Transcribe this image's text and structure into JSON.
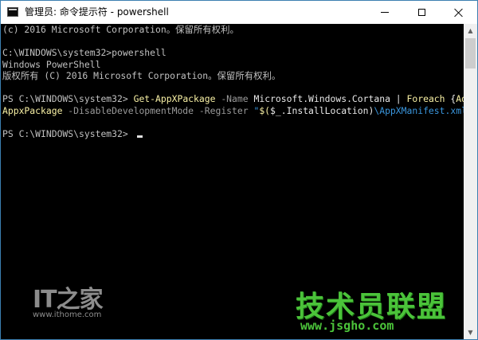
{
  "window": {
    "title": "管理员: 命令提示符 - powershell",
    "icon": "console-icon",
    "controls": {
      "minimize_icon": "minimize-icon",
      "maximize_icon": "maximize-icon",
      "close_icon": "close-icon"
    }
  },
  "console": {
    "lines": [
      "(c) 2016 Microsoft Corporation。保留所有权利。",
      "",
      "C:\\WINDOWS\\system32>powershell",
      "Windows PowerShell",
      "版权所有 (C) 2016 Microsoft Corporation。保留所有权利。",
      ""
    ],
    "command_line_1": {
      "prompt": "PS C:\\WINDOWS\\system32> ",
      "cmdlet": "Get-AppXPackage",
      "param_name": " -Name ",
      "package_name": "Microsoft.Windows.Cortana",
      "pipe": " | ",
      "foreach": "Foreach",
      "brace_open": " {",
      "add_cmd": "Add-"
    },
    "command_line_2": {
      "add_cmd_cont": "AppxPackage",
      "param_disable": " -DisableDevelopmentMode",
      "param_register": " -Register ",
      "quote_open": "\"",
      "subexpr_open": "$(",
      "var": "$_",
      "install_location": ".InstallLocation)",
      "manifest": "\\AppXManifest.xml",
      "quote_close": "\"",
      "brace_close": "}"
    },
    "final_prompt": "PS C:\\WINDOWS\\system32> "
  },
  "scrollbar": {
    "up_arrow": "▲",
    "down_arrow": "▼"
  },
  "watermarks": {
    "ithome_logo": "IT之家",
    "ithome_url": "www.ithome.com",
    "jsgho_logo": "技术员联盟",
    "jsgho_url": "www.jsgho.com"
  },
  "colors": {
    "title_bar_bg": "#ffffff",
    "console_bg": "#000000",
    "console_text": "#c0c0c0",
    "cmdlet_yellow": "#f9f1a5",
    "param_gray": "#9a9a9a",
    "string_cyan": "#3a96dd",
    "watermark_green": "#4bc33a"
  }
}
